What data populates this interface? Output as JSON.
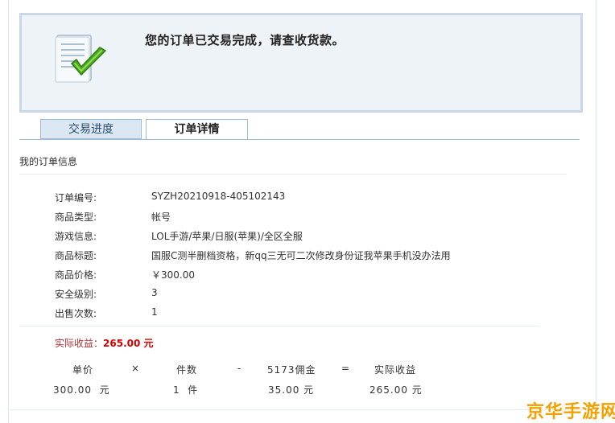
{
  "banner": {
    "message": "您的订单已交易完成，请查收货款。"
  },
  "tabs": [
    {
      "label": "交易进度"
    },
    {
      "label": "订单详情"
    }
  ],
  "section": {
    "title": "我的订单信息"
  },
  "order_info": [
    {
      "label": "订单编号:",
      "value": "SYZH20210918-405102143"
    },
    {
      "label": "商品类型:",
      "value": "帐号"
    },
    {
      "label": "游戏信息:",
      "value": "LOL手游/苹果/日服(苹果)/全区全服"
    },
    {
      "label": "商品标题:",
      "value": "国服C测半删档资格，新qq三无可二次修改身份证我苹果手机没办法用"
    },
    {
      "label": "商品价格:",
      "value": "￥300.00"
    },
    {
      "label": "安全级别:",
      "value": "3"
    },
    {
      "label": "出售次数:",
      "value": "1"
    }
  ],
  "earnings": {
    "label": "实际收益：",
    "value": "265.00 元"
  },
  "calc": {
    "headers": [
      "单价",
      "×",
      "件数",
      "-",
      "5173佣金",
      "=",
      "实际收益"
    ],
    "values": [
      "300.00  元",
      "1  件",
      "35.00 元",
      "265.00 元"
    ]
  },
  "watermark": {
    "text": "京华手游网"
  },
  "colors": {
    "banner_bg": "#eef3f8",
    "banner_border": "#c9d7e6",
    "tab_active": "#ffffff",
    "tab_inactive": "#dbe7f3",
    "earn_red": "#d40000",
    "watermark": "#f3a100"
  }
}
